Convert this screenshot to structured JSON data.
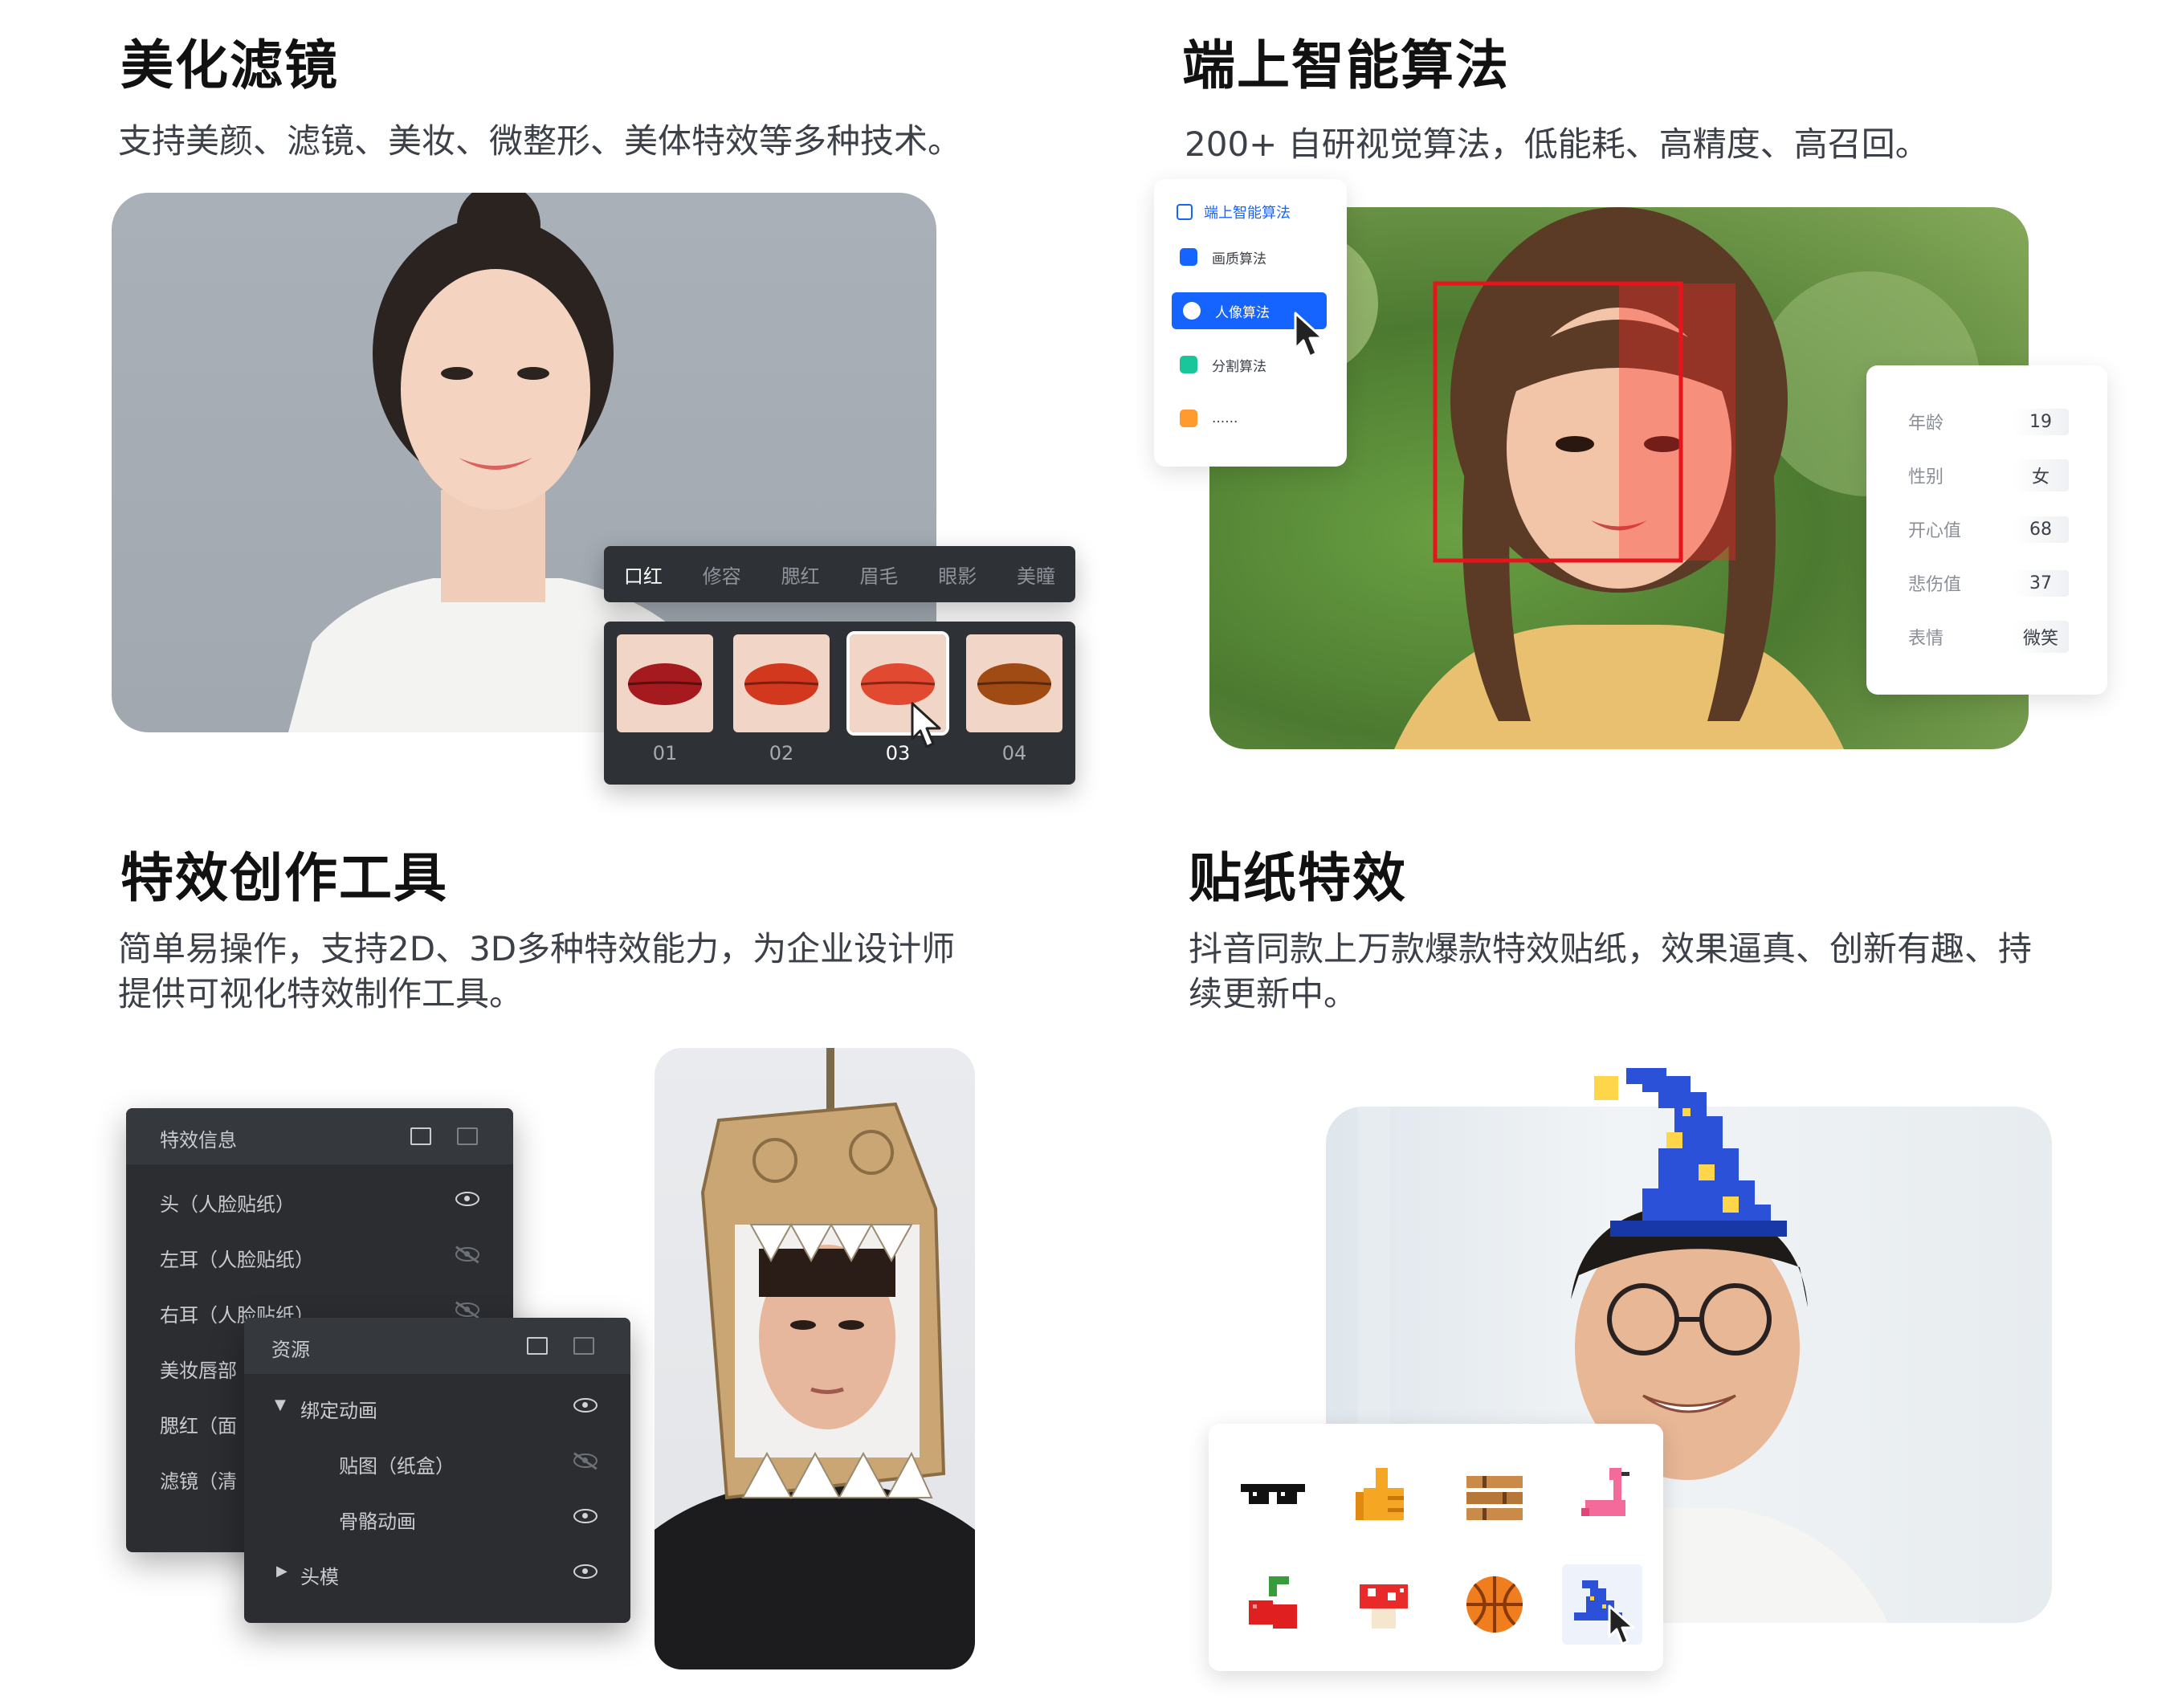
{
  "beauty": {
    "title": "美化滤镜",
    "desc": "支持美颜、滤镜、美妆、微整形、美体特效等多种技术。",
    "tabs": [
      "口红",
      "修容",
      "腮红",
      "眉毛",
      "眼影",
      "美瞳"
    ],
    "lipsticks": [
      {
        "label": "01",
        "color": "#a51a1e"
      },
      {
        "label": "02",
        "color": "#d2381e"
      },
      {
        "label": "03",
        "color": "#e14a31"
      },
      {
        "label": "04",
        "color": "#a04a14"
      }
    ],
    "selected_lipstick": "03"
  },
  "algo": {
    "title": "端上智能算法",
    "desc": "200+ 自研视觉算法，低能耗、高精度、高召回。",
    "menu_title": "端上智能算法",
    "menu": [
      {
        "label": "画质算法",
        "icon": "grid-icon",
        "color": "#1664ff"
      },
      {
        "label": "人像算法",
        "icon": "portrait-icon",
        "color": "#ffffff"
      },
      {
        "label": "分割算法",
        "icon": "segment-icon",
        "color": "#19c59a"
      },
      {
        "label": "......",
        "icon": "ad-icon",
        "color": "#ff9a2e"
      }
    ],
    "active_menu": "人像算法",
    "attributes": [
      {
        "label": "年龄",
        "value": "19"
      },
      {
        "label": "性别",
        "value": "女"
      },
      {
        "label": "开心值",
        "value": "68"
      },
      {
        "label": "悲伤值",
        "value": "37"
      },
      {
        "label": "表情",
        "value": "微笑"
      }
    ],
    "face_box_color": "#e8141c"
  },
  "tool": {
    "title": "特效创作工具",
    "desc_line1": "简单易操作，支持2D、3D多种特效能力，为企业设计师",
    "desc_line2": "提供可视化特效制作工具。",
    "panel1_title": "特效信息",
    "panel1_rows": [
      {
        "label": "头（人脸贴纸）",
        "visible": true
      },
      {
        "label": "左耳（人脸贴纸）",
        "visible": false
      },
      {
        "label": "右耳（人脸贴纸）",
        "visible": false
      },
      {
        "label": "美妆唇部",
        "visible": true
      },
      {
        "label": "腮红（面",
        "visible": true
      },
      {
        "label": "滤镜（清",
        "visible": true
      }
    ],
    "panel2_title": "资源",
    "panel2_rows": [
      {
        "label": "绑定动画",
        "visible": true,
        "arrow": "▼"
      },
      {
        "label": "贴图（纸盒）",
        "visible": false,
        "arrow": ""
      },
      {
        "label": "骨骼动画",
        "visible": true,
        "arrow": ""
      },
      {
        "label": "头模",
        "visible": true,
        "arrow": "▶"
      }
    ]
  },
  "sticker": {
    "title": "贴纸特效",
    "desc_line1": "抖音同款上万款爆款特效贴纸，效果逼真、创新有趣、持",
    "desc_line2": "续更新中。",
    "stickers": [
      {
        "icon": "pixel-sunglasses-icon"
      },
      {
        "icon": "pixel-thumbs-up-icon"
      },
      {
        "icon": "pixel-bricks-icon"
      },
      {
        "icon": "pixel-flamingo-icon"
      },
      {
        "icon": "pixel-cherry-icon"
      },
      {
        "icon": "pixel-mushroom-icon"
      },
      {
        "icon": "pixel-basketball-icon"
      },
      {
        "icon": "pixel-wizard-hat-icon"
      }
    ]
  },
  "colors": {
    "accent": "#1664ff",
    "panel_dark": "#2b2d31"
  }
}
